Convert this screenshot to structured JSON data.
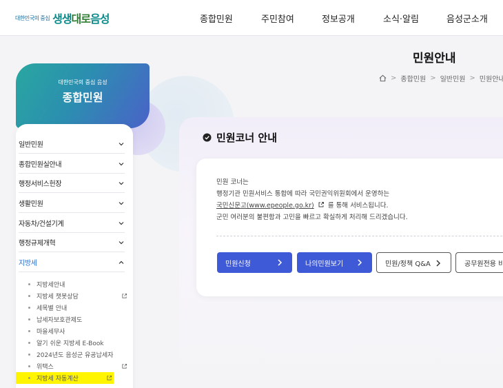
{
  "header": {
    "logo_small": "대한민국의 중심",
    "logo_big_a": "생생",
    "logo_big_b": "대로",
    "logo_big_c": "음성",
    "nav": [
      "종합민원",
      "주민참여",
      "정보공개",
      "소식·알림",
      "음성군소개"
    ]
  },
  "page": {
    "title": "민원안내",
    "breadcrumb": [
      "종합민원",
      "일반민원",
      "민원안내"
    ]
  },
  "side": {
    "banner_sub": "대한민국의 중심 음성",
    "banner_title": "종합민원",
    "menu": [
      {
        "label": "일반민원",
        "state": "collapsed"
      },
      {
        "label": "종합민원실안내",
        "state": "collapsed"
      },
      {
        "label": "행정서비스헌장",
        "state": "collapsed"
      },
      {
        "label": "생활민원",
        "state": "collapsed"
      },
      {
        "label": "자동차/건설기계",
        "state": "collapsed"
      },
      {
        "label": "행정규제개혁",
        "state": "collapsed"
      },
      {
        "label": "지방세",
        "state": "expanded"
      }
    ],
    "submenu": [
      {
        "label": "지방세안내",
        "external": false
      },
      {
        "label": "지방세 챗봇상담",
        "external": true
      },
      {
        "label": "세목별 안내",
        "external": false
      },
      {
        "label": "납세자보호관제도",
        "external": false
      },
      {
        "label": "마을세무사",
        "external": false
      },
      {
        "label": "알기 쉬운 지방세 E-Book",
        "external": false
      },
      {
        "label": "2024년도 음성군 유공납세자",
        "external": false
      },
      {
        "label": "위택스",
        "external": true
      },
      {
        "label": "지방세 자동계산",
        "external": true,
        "highlighted": true
      }
    ],
    "highlight_color": "#fff500"
  },
  "main": {
    "section_title": "민원코너 안내",
    "line1": "민원 코너는",
    "line2": "행정기관 민원서비스 통합에 따라 국민권익위원회에서 운영하는",
    "line3_link": "국민신문고(www.epeople.go.kr)",
    "line3_rest": "를 통해 서비스됩니다.",
    "line4": "군민 여러분의 불편함과 고민을 빠르고 확실하게 처리해 드리겠습니다.",
    "buttons": [
      {
        "label": "민원신청",
        "style": "primary"
      },
      {
        "label": "나의민원보기",
        "style": "primary"
      },
      {
        "label": "민원/정책 Q&A",
        "style": "outline"
      },
      {
        "label": "공무원전용 비",
        "style": "outline"
      }
    ]
  },
  "colors": {
    "primary_button": "#3f5ad6",
    "active_menu": "#2b6fd0",
    "banner_start": "#2aa7a0",
    "banner_end": "#4a62c8"
  }
}
